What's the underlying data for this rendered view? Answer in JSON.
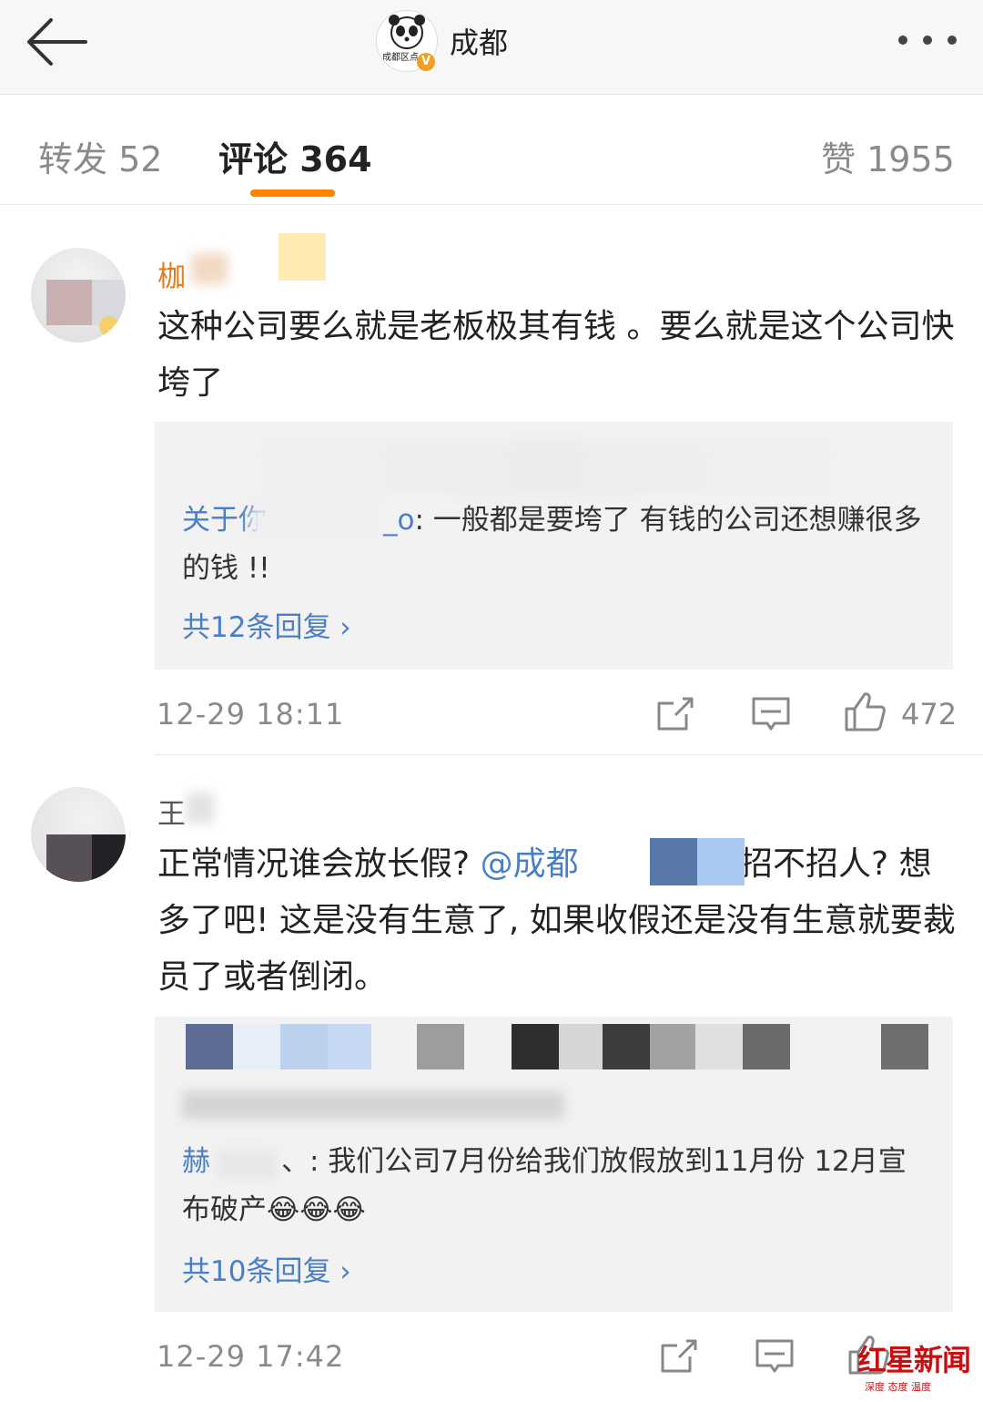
{
  "topbar": {
    "title": "成都",
    "avatar_text": "成都区点"
  },
  "tabs": {
    "repost": "转发 52",
    "comment": "评论 364",
    "like": "赞 1955"
  },
  "comments": [
    {
      "username": "枷",
      "text": "这种公司要么就是老板极其有钱 。要么就是这个公司快垮了",
      "reply_name": "关于你",
      "reply_name_tail": "_o",
      "reply_text": ": 一般都是要垮了  有钱的公司还想赚很多的钱  !!",
      "reply_more": "共12条回复 ›",
      "time": "12-29 18:11",
      "likes": "472"
    },
    {
      "username": "王",
      "text_before": "正常情况谁会放长假? ",
      "mention": "@成都",
      "text_after": " 还招不招人? 想多了吧! 这是没有生意了, 如果收假还是没有生意就要裁员了或者倒闭。",
      "reply_name": "赫",
      "reply_text": "、: 我们公司7月份给我们放假放到11月份 12月宣布破产😂😂😂",
      "reply_more": "共10条回复 ›",
      "time": "12-29 17:42"
    }
  ],
  "watermark": {
    "main": "红星新闻",
    "sub": "深度 态度 温度"
  }
}
